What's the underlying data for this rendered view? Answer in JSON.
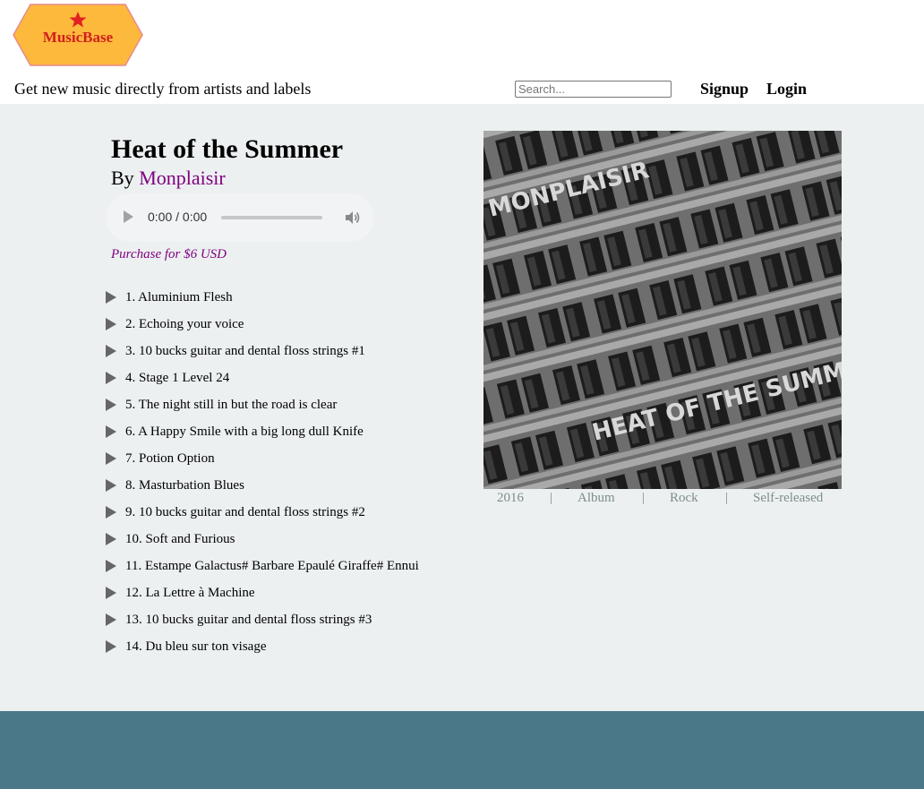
{
  "header": {
    "logo_text": "MusicBase",
    "tagline": "Get new music directly from artists and labels",
    "search_placeholder": "Search...",
    "signup_label": "Signup",
    "login_label": "Login"
  },
  "album": {
    "title": "Heat of the Summer",
    "by_prefix": "By",
    "artist": "Monplaisir",
    "purchase": "Purchase for $6 USD",
    "cover_text_artist": "MONPLAISIR",
    "cover_text_title": "HEAT OF THE SUMMER",
    "meta": {
      "year": "2016",
      "type": "Album",
      "genre": "Rock",
      "label": "Self-released",
      "separator": "|"
    }
  },
  "player": {
    "time": "0:00 / 0:00",
    "progress": 0
  },
  "tracks": [
    "1. Aluminium Flesh",
    "2. Echoing your voice",
    "3. 10 bucks guitar and dental floss strings #1",
    "4. Stage 1 Level 24",
    "5. The night still in but the road is clear",
    "6. A Happy Smile with a big long dull Knife",
    "7. Potion Option",
    "8. Masturbation Blues",
    "9. 10 bucks guitar and dental floss strings #2",
    "10. Soft and Furious",
    "11. Estampe Galactus# Barbare Epaulé Giraffe# Ennui",
    "12. La Lettre à Machine",
    "13. 10 bucks guitar and dental floss strings #3",
    "14. Du bleu sur ton visage"
  ],
  "colors": {
    "logo_fill": "#fdb93b",
    "logo_star": "#e32020",
    "artist_link": "#800080",
    "main_bg": "#ecf0f1",
    "footer_bg": "#4a7888",
    "meta_text": "#7f8c8d"
  }
}
